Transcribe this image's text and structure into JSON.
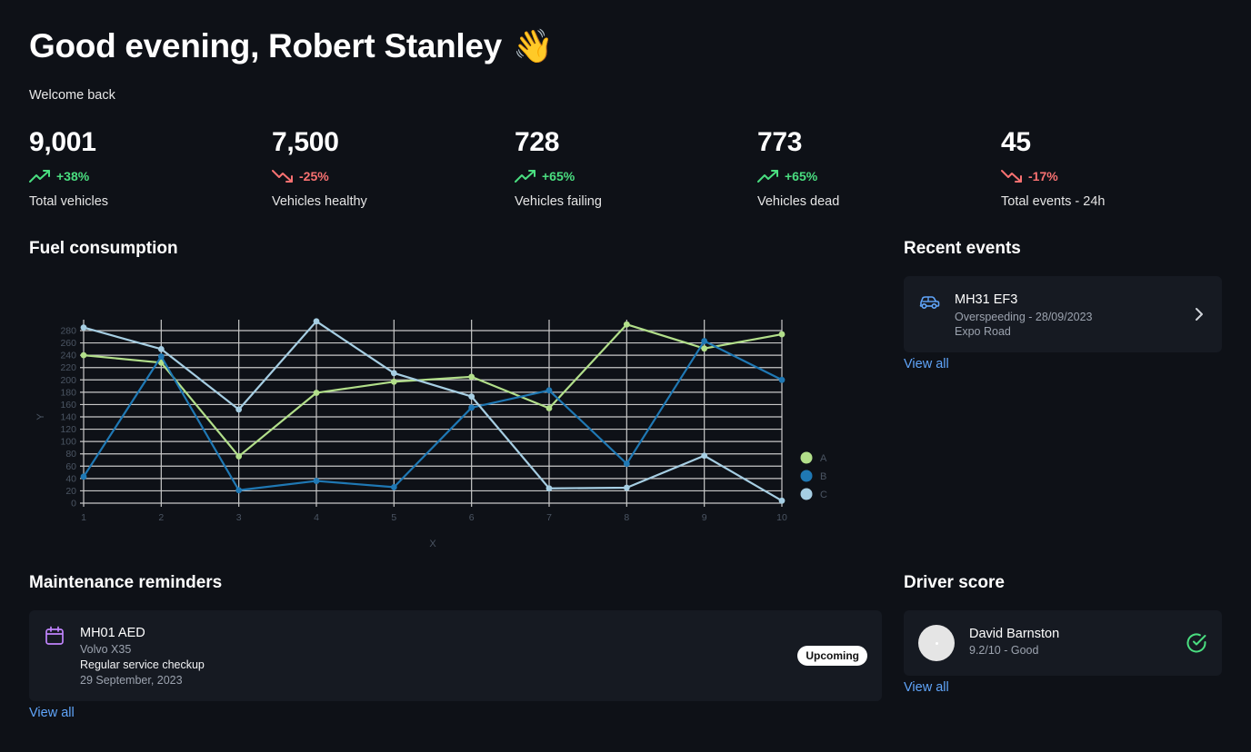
{
  "header": {
    "greeting": "Good evening, Robert Stanley",
    "wave_emoji": "👋",
    "subtitle": "Welcome back"
  },
  "stats": [
    {
      "value": "9,001",
      "change": "+38%",
      "trend": "up",
      "label": "Total vehicles"
    },
    {
      "value": "7,500",
      "change": "-25%",
      "trend": "down",
      "label": "Vehicles healthy"
    },
    {
      "value": "728",
      "change": "+65%",
      "trend": "up",
      "label": "Vehicles failing"
    },
    {
      "value": "773",
      "change": "+65%",
      "trend": "up",
      "label": "Vehicles dead"
    },
    {
      "value": "45",
      "change": "-17%",
      "trend": "down",
      "label": "Total events - 24h"
    }
  ],
  "fuel": {
    "title": "Fuel consumption"
  },
  "chart_data": {
    "type": "line",
    "x": [
      1,
      2,
      3,
      4,
      5,
      6,
      7,
      8,
      9,
      10
    ],
    "xlabel": "X",
    "ylabel": "Y",
    "ylim": [
      0,
      280
    ],
    "yticks": [
      0,
      20,
      40,
      60,
      80,
      100,
      120,
      140,
      160,
      180,
      200,
      220,
      240,
      260,
      280
    ],
    "grid": true,
    "legend_position": "right",
    "series": [
      {
        "name": "A",
        "color": "#b2df8a",
        "values": [
          240,
          228,
          76,
          179,
          197,
          205,
          154,
          290,
          251,
          274
        ]
      },
      {
        "name": "B",
        "color": "#1f78b4",
        "values": [
          43,
          238,
          21,
          36,
          26,
          155,
          183,
          64,
          263,
          200
        ]
      },
      {
        "name": "C",
        "color": "#a6cee3",
        "values": [
          285,
          250,
          152,
          295,
          211,
          173,
          24,
          25,
          77,
          4
        ]
      }
    ]
  },
  "recent_events": {
    "title": "Recent events",
    "items": [
      {
        "plate": "MH31 EF3",
        "detail": "Overspeeding - 28/09/2023",
        "location": "Expo Road",
        "icon": "car-icon"
      }
    ],
    "view_all": "View all"
  },
  "maintenance": {
    "title": "Maintenance reminders",
    "items": [
      {
        "plate": "MH01 AED",
        "model": "Volvo X35",
        "task": "Regular service checkup",
        "date": "29 September, 2023",
        "status": "Upcoming",
        "icon": "calendar-icon"
      }
    ],
    "view_all": "View all"
  },
  "driver_score": {
    "title": "Driver score",
    "items": [
      {
        "name": "David Barnston",
        "score": "9.2/10 - Good",
        "icon": "check-circle-icon"
      }
    ],
    "view_all": "View all"
  },
  "colors": {
    "background": "#0e1117",
    "card": "#161a22",
    "link": "#60a5fa",
    "up": "#4ade80",
    "down": "#f87171",
    "calendar_icon": "#c084fc",
    "car_icon": "#60a5fa",
    "check_icon": "#4ade80"
  }
}
